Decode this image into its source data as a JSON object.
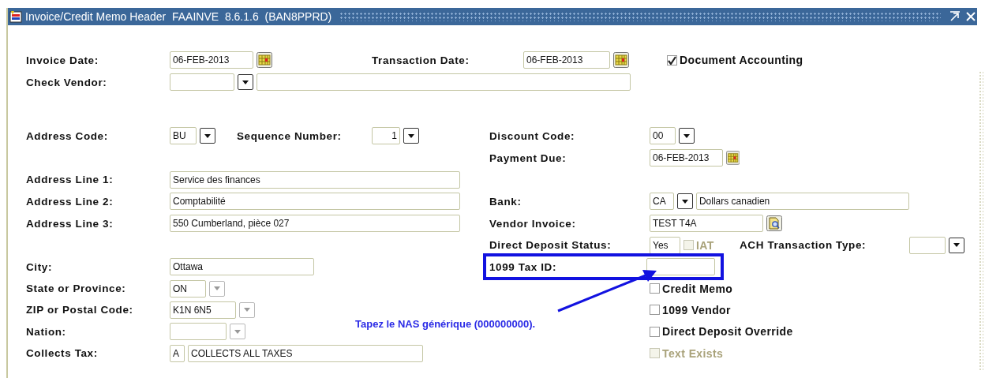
{
  "window": {
    "title": "Invoice/Credit Memo Header  FAAINVE  8.6.1.6  (BAN8PPRD)"
  },
  "form": {
    "invoice_date": {
      "label": "Invoice Date:",
      "value": "06-FEB-2013"
    },
    "transaction_date": {
      "label": "Transaction Date:",
      "value": "06-FEB-2013"
    },
    "document_accounting": {
      "label": "Document Accounting",
      "checked": true,
      "disabled": false
    },
    "check_vendor": {
      "label": "Check Vendor:"
    },
    "address_code": {
      "label": "Address Code:",
      "value": "BU"
    },
    "sequence_number": {
      "label": "Sequence Number:",
      "value": "1"
    },
    "discount_code": {
      "label": "Discount Code:",
      "value": "00"
    },
    "payment_due": {
      "label": "Payment Due:",
      "value": "06-FEB-2013"
    },
    "address_lines": [
      {
        "label": "Address Line 1:",
        "value": "Service des finances"
      },
      {
        "label": "Address Line 2:",
        "value": "Comptabilité"
      },
      {
        "label": "Address Line 3:",
        "value": "550 Cumberland, pièce 027"
      }
    ],
    "bank": {
      "label": "Bank:",
      "code": "CA",
      "name": "Dollars canadien"
    },
    "vendor_invoice": {
      "label": "Vendor Invoice:",
      "value": "TEST T4A"
    },
    "direct_deposit_status": {
      "label": "Direct Deposit Status:",
      "value": "Yes"
    },
    "iat": {
      "label": "IAT",
      "checked": false,
      "disabled": true
    },
    "ach_transaction_type": {
      "label": "ACH Transaction Type:"
    },
    "city": {
      "label": "City:",
      "value": "Ottawa"
    },
    "tax_id": {
      "label": "1099 Tax ID:",
      "highlighted": true
    },
    "state": {
      "label": "State or Province:",
      "value": "ON",
      "disabled": true
    },
    "zip": {
      "label": "ZIP or Postal Code:",
      "value": "K1N 6N5",
      "disabled": true
    },
    "nation": {
      "label": "Nation:",
      "disabled": true
    },
    "collects_tax": {
      "label": "Collects Tax:",
      "code": "A",
      "name": "COLLECTS ALL TAXES"
    },
    "options": [
      {
        "label": "Credit Memo",
        "checked": false,
        "disabled": false
      },
      {
        "label": "1099 Vendor",
        "checked": false,
        "disabled": false
      },
      {
        "label": "Direct Deposit Override",
        "checked": false,
        "disabled": false
      },
      {
        "label": "Text Exists",
        "checked": false,
        "disabled": true
      }
    ]
  },
  "annotation": {
    "text": "Tapez le NAS générique (000000000)."
  }
}
